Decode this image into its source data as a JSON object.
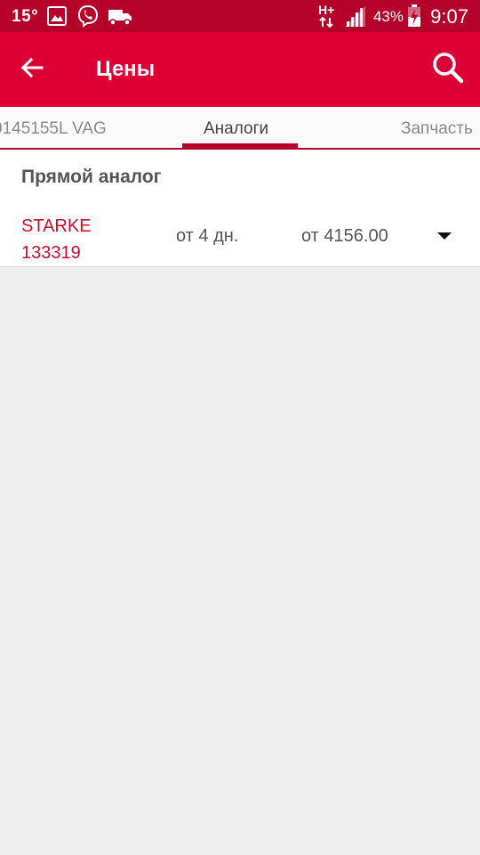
{
  "status_bar": {
    "temperature": "15°",
    "battery": "43%",
    "time": "9:07",
    "icons": [
      "image-icon",
      "viber-icon",
      "truck-icon",
      "network-hplus-icon",
      "signal-icon",
      "battery-icon"
    ]
  },
  "app_bar": {
    "title": "Цены",
    "back_icon": "arrow-back-icon",
    "search_icon": "search-icon",
    "color": "#dc0034"
  },
  "tabs": [
    {
      "label": "0145155L VAG",
      "active": false
    },
    {
      "label": "Аналоги",
      "active": true
    },
    {
      "label": "Запчасть",
      "active": false
    }
  ],
  "section": {
    "title": "Прямой аналог",
    "items": [
      {
        "brand": "STARKE",
        "part_number": "133319",
        "delivery": "от 4 дн.",
        "price": "от 4156.00",
        "expand_icon": "caret-down-icon"
      }
    ]
  },
  "colors": {
    "accent": "#dc0034",
    "status_bar": "#b5002a",
    "brand_text": "#c8102e",
    "background": "#eeeeee"
  }
}
